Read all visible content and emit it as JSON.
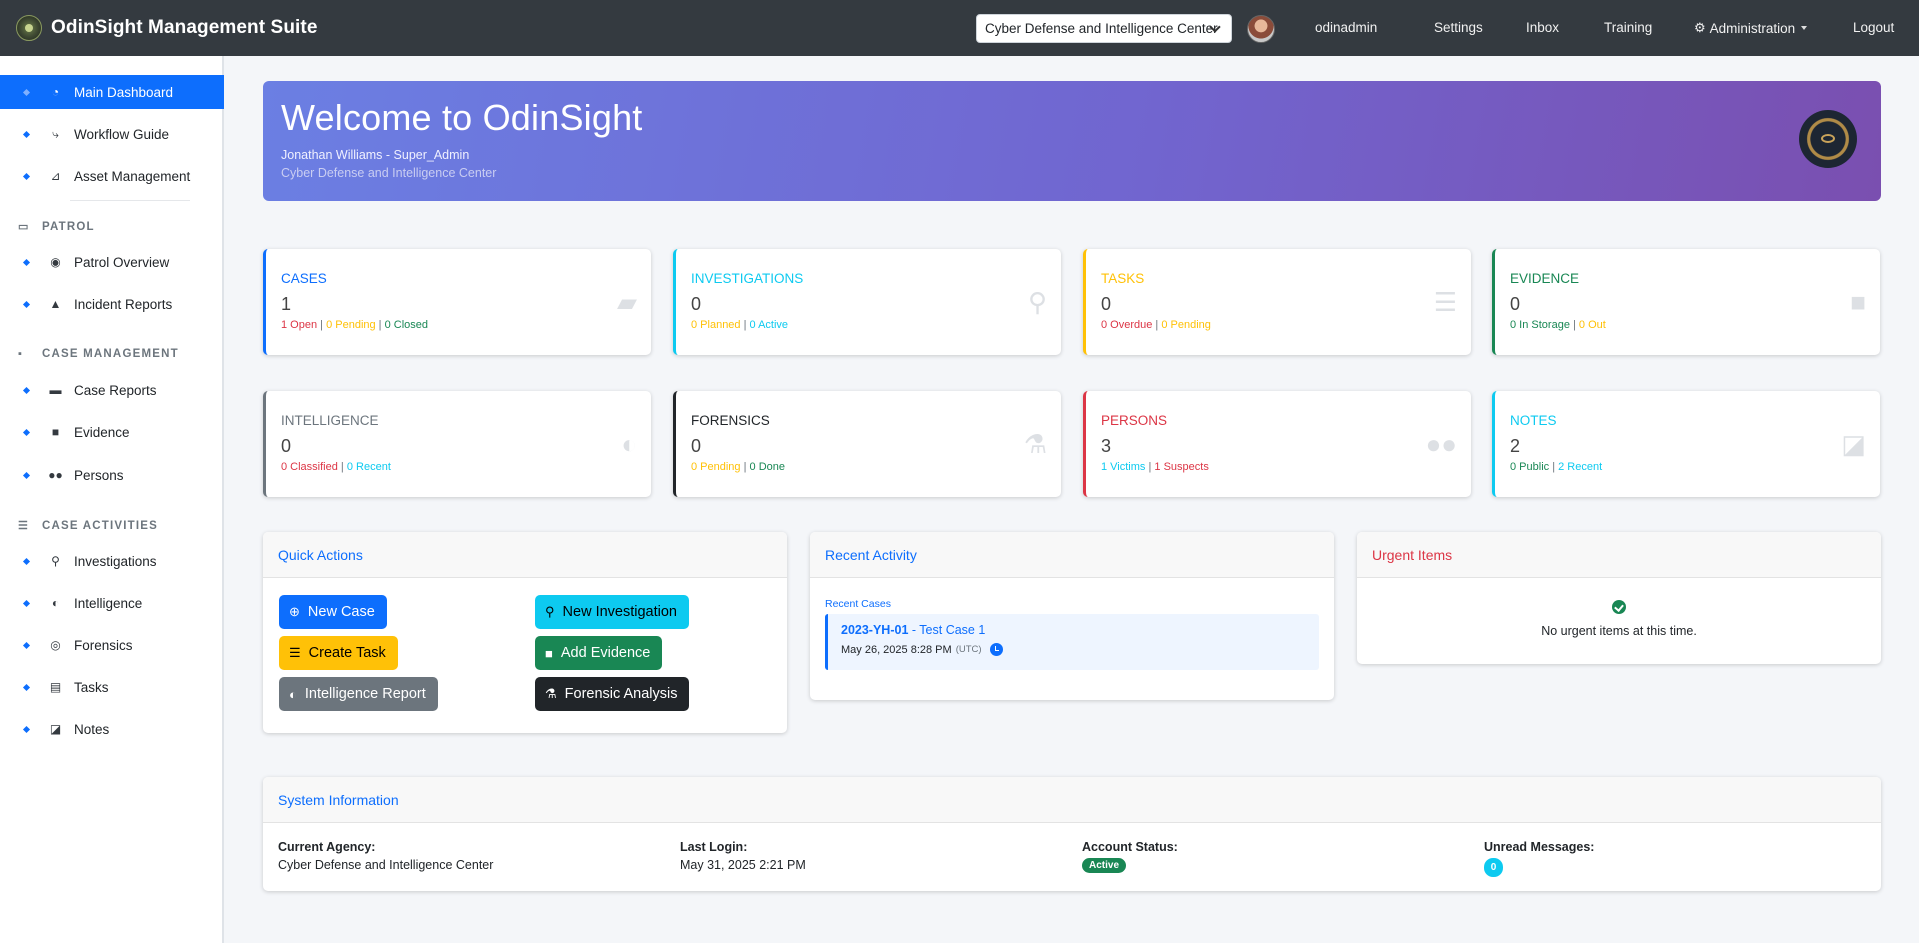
{
  "app": {
    "title": "OdinSight Management Suite",
    "agency_selected": "Cyber Defense and Intelligence Center",
    "username": "odinadmin"
  },
  "nav": {
    "settings": "Settings",
    "inbox": "Inbox",
    "training": "Training",
    "administration": "Administration",
    "logout": "Logout"
  },
  "sidebar": {
    "items": [
      {
        "label": "Main Dashboard",
        "icon": "gauge-icon",
        "active": true
      },
      {
        "label": "Workflow Guide",
        "icon": "route-icon"
      },
      {
        "label": "Asset Management",
        "icon": "dolly-icon"
      }
    ],
    "patrol": {
      "heading": "PATROL",
      "items": [
        {
          "label": "Patrol Overview",
          "icon": "eye-icon"
        },
        {
          "label": "Incident Reports",
          "icon": "warning-icon"
        }
      ]
    },
    "case_management": {
      "heading": "CASE MANAGEMENT",
      "items": [
        {
          "label": "Case Reports",
          "icon": "folder-icon"
        },
        {
          "label": "Evidence",
          "icon": "box-icon"
        },
        {
          "label": "Persons",
          "icon": "users-icon"
        }
      ]
    },
    "case_activities": {
      "heading": "CASE ACTIVITIES",
      "items": [
        {
          "label": "Investigations",
          "icon": "search-icon"
        },
        {
          "label": "Intelligence",
          "icon": "brain-icon"
        },
        {
          "label": "Forensics",
          "icon": "fingerprint-icon"
        },
        {
          "label": "Tasks",
          "icon": "clipboard-icon"
        },
        {
          "label": "Notes",
          "icon": "note-icon"
        }
      ]
    }
  },
  "welcome": {
    "heading": "Welcome to OdinSight",
    "user_line": "Jonathan Williams - Super_Admin",
    "agency_line": "Cyber Defense and Intelligence Center"
  },
  "stats": {
    "cases": {
      "title": "CASES",
      "count": "1",
      "a": "1 Open",
      "b": "0 Pending",
      "c": "0 Closed",
      "color": "#0d6efd"
    },
    "investigations": {
      "title": "INVESTIGATIONS",
      "count": "0",
      "a": "0 Planned",
      "b": "0 Active",
      "color": "#0dcaf0"
    },
    "tasks": {
      "title": "TASKS",
      "count": "0",
      "a": "0 Overdue",
      "b": "0 Pending",
      "color": "#ffc107"
    },
    "evidence": {
      "title": "EVIDENCE",
      "count": "0",
      "a": "0 In Storage",
      "b": "0 Out",
      "color": "#198754"
    },
    "intelligence": {
      "title": "INTELLIGENCE",
      "count": "0",
      "a": "0 Classified",
      "b": "0 Recent",
      "color": "#6c757d"
    },
    "forensics": {
      "title": "FORENSICS",
      "count": "0",
      "a": "0 Pending",
      "b": "0 Done",
      "color": "#212529"
    },
    "persons": {
      "title": "PERSONS",
      "count": "3",
      "a": "1 Victims",
      "b": "1 Suspects",
      "color": "#dc3545"
    },
    "notes": {
      "title": "NOTES",
      "count": "2",
      "a": "0 Public",
      "b": "2 Recent",
      "color": "#0dcaf0"
    }
  },
  "quick_actions": {
    "title": "Quick Actions",
    "new_case": "New Case",
    "new_investigation": "New Investigation",
    "create_task": "Create Task",
    "add_evidence": "Add Evidence",
    "intelligence_report": "Intelligence Report",
    "forensic_analysis": "Forensic Analysis"
  },
  "recent_activity": {
    "title": "Recent Activity",
    "section": "Recent Cases",
    "items": [
      {
        "case_number": "2023-YH-01",
        "case_title": "Test Case 1",
        "date": "May 26, 2025 8:28 PM",
        "tz": "(UTC)"
      }
    ]
  },
  "urgent": {
    "title": "Urgent Items",
    "empty_text": "No urgent items at this time."
  },
  "system_info": {
    "title": "System Information",
    "agency_label": "Current Agency:",
    "agency_value": "Cyber Defense and Intelligence Center",
    "login_label": "Last Login:",
    "login_value": "May 31, 2025 2:21 PM",
    "status_label": "Account Status:",
    "status_value": "Active",
    "messages_label": "Unread Messages:",
    "messages_value": "0"
  }
}
